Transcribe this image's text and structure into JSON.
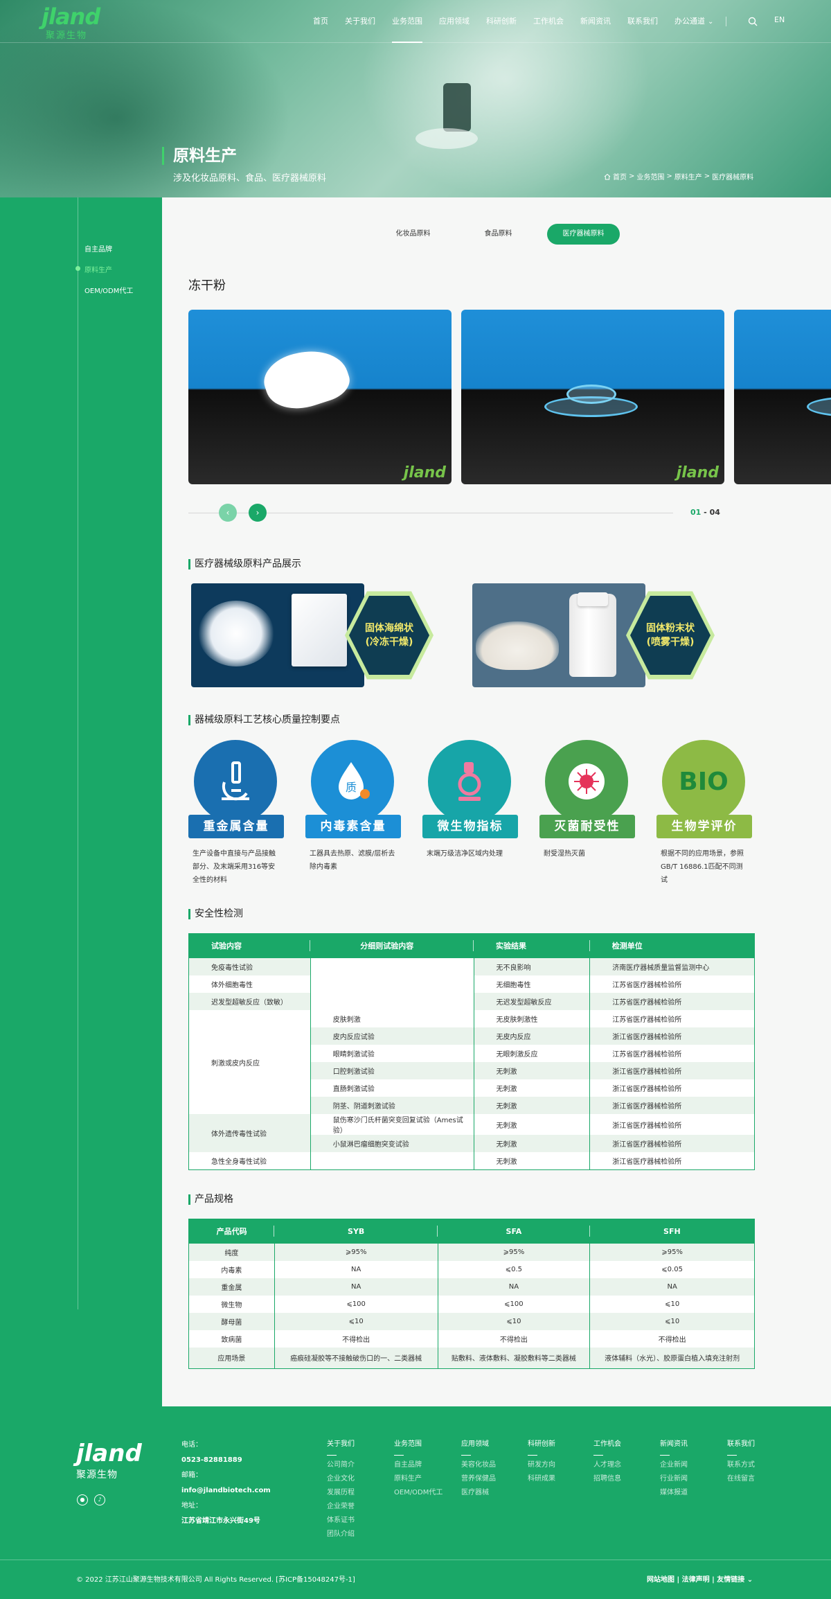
{
  "header": {
    "logo_word": "jland",
    "logo_cn": "聚源生物",
    "nav": [
      {
        "label": "首页",
        "active": false
      },
      {
        "label": "关于我们",
        "active": false
      },
      {
        "label": "业务范围",
        "active": true
      },
      {
        "label": "应用领域",
        "active": false
      },
      {
        "label": "科研创新",
        "active": false
      },
      {
        "label": "工作机会",
        "active": false
      },
      {
        "label": "新闻资讯",
        "active": false
      },
      {
        "label": "联系我们",
        "active": false
      },
      {
        "label": "办公通道",
        "active": false
      }
    ],
    "lang": "EN"
  },
  "hero": {
    "title": "原料生产",
    "subtitle": "涉及化妆品原料、食品、医疗器械原料",
    "breadcrumb": [
      "首页",
      "业务范围",
      "原料生产",
      "医疗器械原料"
    ]
  },
  "sidebar": {
    "items": [
      {
        "label": "自主品牌",
        "active": false
      },
      {
        "label": "原料生产",
        "active": true
      },
      {
        "label": "OEM/ODM代工",
        "active": false
      }
    ]
  },
  "tabs": [
    {
      "label": "化妆品原料",
      "active": false
    },
    {
      "label": "食品原料",
      "active": false
    },
    {
      "label": "医疗器械原料",
      "active": true
    }
  ],
  "gallery": {
    "title": "冻干粉",
    "watermark": "jland",
    "current": "01",
    "separator": "-",
    "total": "04"
  },
  "showcase": {
    "title": "医疗器械级原料产品展示",
    "cards": [
      {
        "label_line1": "固体海绵状",
        "label_line2": "(冷冻干燥)"
      },
      {
        "label_line1": "固体粉末状",
        "label_line2": "(喷雾干燥)"
      }
    ]
  },
  "quality": {
    "title": "器械级原料工艺核心质量控制要点",
    "items": [
      {
        "label": "重金属含量",
        "desc": "生产设备中直接与产品接触部分、及末端采用316等安全性的材料",
        "color": "#1a6fb0",
        "icon": "microscope-icon"
      },
      {
        "label": "内毒素含量",
        "desc": "工器具去热原、滤膜/层析去除内毒素",
        "color": "#1c8fd6",
        "icon": "quality-drop-icon",
        "icon_text": "质"
      },
      {
        "label": "微生物指标",
        "desc": "末端万级洁净区域内处理",
        "color": "#17a5a8",
        "icon": "lab-microscope-icon"
      },
      {
        "label": "灭菌耐受性",
        "desc": "耐受湿热灭菌",
        "color": "#4aa14f",
        "icon": "virus-icon"
      },
      {
        "label": "生物学评价",
        "desc": "根据不同的应用场景，参照GB/T 16886.1匹配不同测试",
        "color": "#8dba45",
        "icon": "bio-icon",
        "icon_text": "BIO"
      }
    ]
  },
  "safety": {
    "title": "安全性检测",
    "headers": [
      "试验内容",
      "分细则试验内容",
      "实验结果",
      "检测单位"
    ],
    "rows": [
      [
        "免疫毒性试验",
        "",
        "无不良影响",
        "济南医疗器械质量监督监测中心"
      ],
      [
        "体外细胞毒性",
        "",
        "无细胞毒性",
        "江苏省医疗器械检验所"
      ],
      [
        "迟发型超敏反应（致敏）",
        "",
        "无迟发型超敏反应",
        "江苏省医疗器械检验所"
      ],
      [
        "刺激或皮内反应",
        "皮肤刺激",
        "无皮肤刺激性",
        "江苏省医疗器械检验所"
      ],
      [
        "",
        "皮内反应试验",
        "无皮内反应",
        "浙江省医疗器械检验所"
      ],
      [
        "",
        "眼睛刺激试验",
        "无眼刺激反应",
        "江苏省医疗器械检验所"
      ],
      [
        "",
        "口腔刺激试验",
        "无刺激",
        "浙江省医疗器械检验所"
      ],
      [
        "",
        "直肠刺激试验",
        "无刺激",
        "浙江省医疗器械检验所"
      ],
      [
        "",
        "阴茎、阴道刺激试验",
        "无刺激",
        "浙江省医疗器械检验所"
      ],
      [
        "体外遗传毒性试验",
        "鼠伤寒沙门氏杆菌突变回复试验（Ames试验）",
        "无刺激",
        "浙江省医疗器械检验所"
      ],
      [
        "",
        "小鼠淋巴瘤细胞突变试验",
        "无刺激",
        "浙江省医疗器械检验所"
      ],
      [
        "急性全身毒性试验",
        "",
        "无刺激",
        "浙江省医疗器械检验所"
      ]
    ]
  },
  "spec": {
    "title": "产品规格",
    "headers": [
      "产品代码",
      "SYB",
      "SFA",
      "SFH"
    ],
    "rows": [
      [
        "纯度",
        "⩾95%",
        "⩾95%",
        "⩾95%"
      ],
      [
        "内毒素",
        "NA",
        "⩽0.5",
        "⩽0.05"
      ],
      [
        "重金属",
        "NA",
        "NA",
        "NA"
      ],
      [
        "微生物",
        "⩽100",
        "⩽100",
        "⩽10"
      ],
      [
        "酵母菌",
        "⩽10",
        "⩽10",
        "⩽10"
      ],
      [
        "致病菌",
        "不得检出",
        "不得检出",
        "不得检出"
      ],
      [
        "应用场景",
        "癌痕硅凝胶等不接触破伤口的一、二类器械",
        "贴敷料、液体敷料、凝胶敷料等二类器械",
        "液体辅料（水光）、胶原蛋白植入填充注射剂"
      ]
    ]
  },
  "footer": {
    "logo_word": "jland",
    "logo_cn": "聚源生物",
    "phone_label": "电话：",
    "phone": "0523-82881889",
    "email_label": "邮箱：",
    "email": "info@jlandbiotech.com",
    "address_label": "地址：",
    "address": "江苏省靖江市永兴街49号",
    "columns": [
      {
        "title": "关于我们",
        "links": [
          "公司简介",
          "企业文化",
          "发展历程",
          "企业荣誉",
          "体系证书",
          "团队介绍"
        ]
      },
      {
        "title": "业务范围",
        "links": [
          "自主品牌",
          "原料生产",
          "OEM/ODM代工"
        ]
      },
      {
        "title": "应用领域",
        "links": [
          "美容化妆品",
          "营养保健品",
          "医疗器械"
        ]
      },
      {
        "title": "科研创新",
        "links": [
          "研发方向",
          "科研成果"
        ]
      },
      {
        "title": "工作机会",
        "links": [
          "人才理念",
          "招聘信息"
        ]
      },
      {
        "title": "新闻资讯",
        "links": [
          "企业新闻",
          "行业新闻",
          "媒体报道"
        ]
      },
      {
        "title": "联系我们",
        "links": [
          "联系方式",
          "在线留言"
        ]
      }
    ],
    "copyright": "© 2022 江苏江山聚源生物技术有限公司 All Rights Reserved. [苏ICP备15048247号-1]",
    "links": "网站地图 | 法律声明 | 友情链接"
  }
}
